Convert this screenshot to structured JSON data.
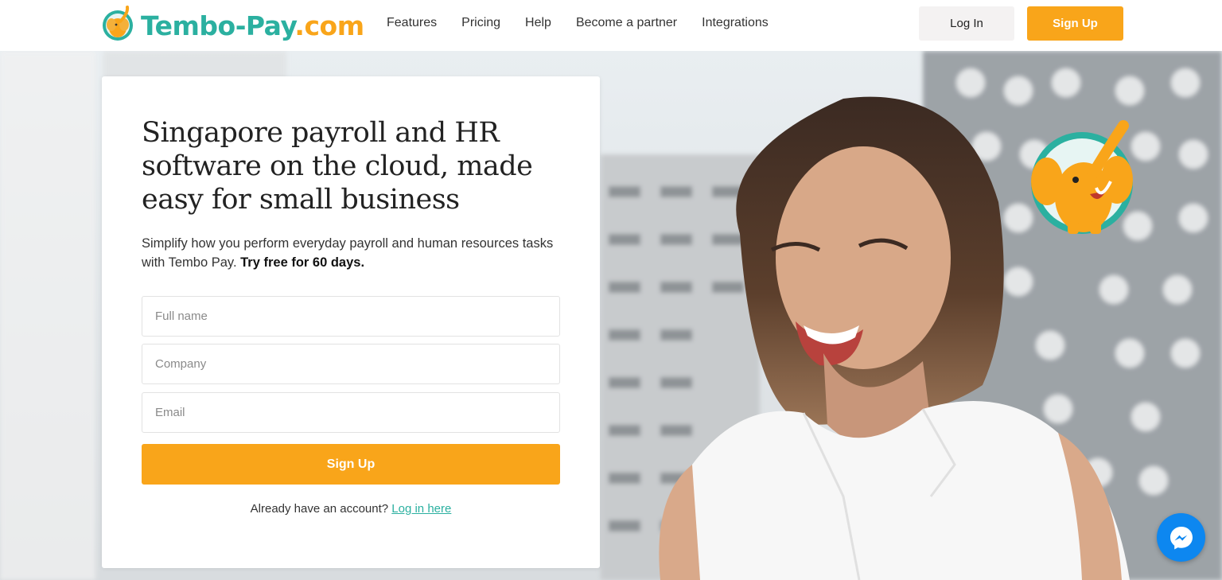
{
  "brand": {
    "name": "Tembo-Pay",
    "tld": ".com",
    "colors": {
      "teal": "#2bb0a0",
      "orange": "#f9a51a"
    }
  },
  "nav": {
    "items": [
      {
        "label": "Features"
      },
      {
        "label": "Pricing"
      },
      {
        "label": "Help"
      },
      {
        "label": "Become a partner"
      },
      {
        "label": "Integrations"
      }
    ]
  },
  "header": {
    "login_label": "Log In",
    "signup_label": "Sign Up"
  },
  "hero": {
    "title": "Singapore payroll and HR software on the cloud, made easy for small business",
    "lead_text": "Simplify how you perform everyday payroll and human resources tasks with Tembo Pay.",
    "lead_bold": "Try free for 60 days."
  },
  "form": {
    "full_name_placeholder": "Full name",
    "company_placeholder": "Company",
    "email_placeholder": "Email",
    "submit_label": "Sign Up",
    "already_text": "Already have an account?",
    "login_link": "Log in here"
  },
  "icons": {
    "logo": "elephant-logo-icon",
    "mascot": "elephant-mascot-icon",
    "chat": "messenger-icon"
  }
}
